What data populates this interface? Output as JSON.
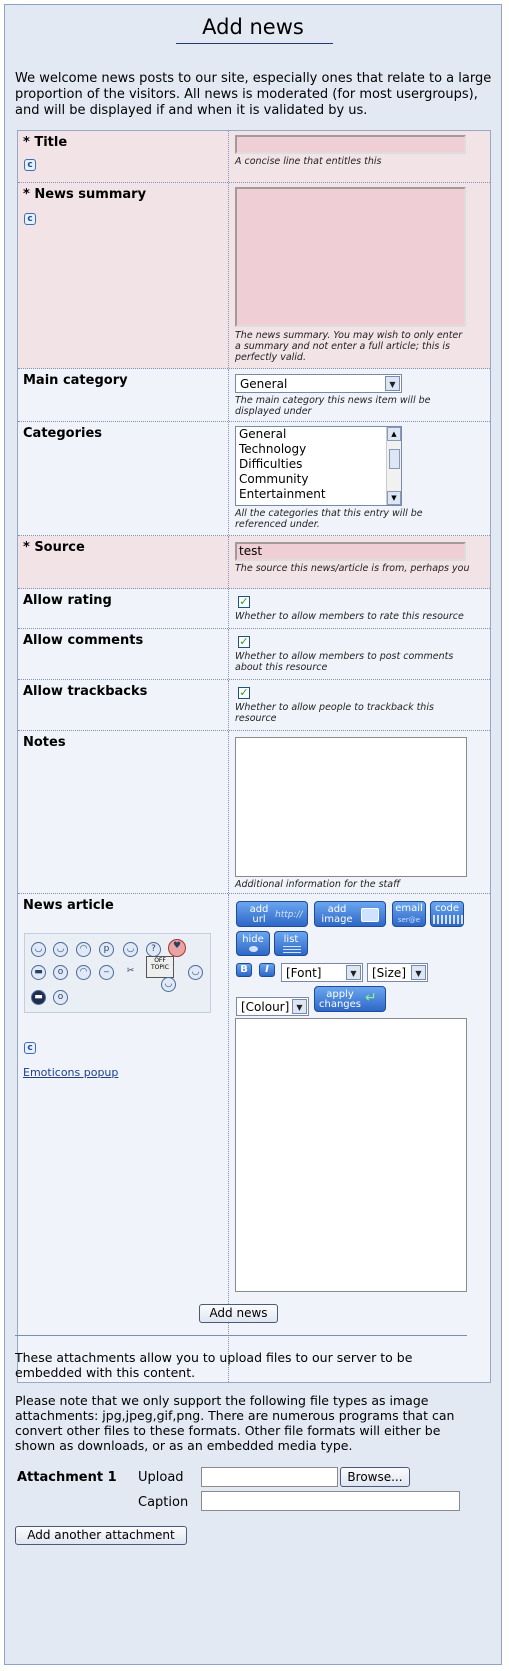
{
  "page": {
    "title": "Add news",
    "intro": "We welcome news posts to our site, especially ones that relate to a large proportion of the visitors. All news is moderated (for most usergroups), and will be displayed if and when it is validated by us."
  },
  "fields": {
    "title": {
      "label": "* Title",
      "value": "",
      "hint": "A concise line that entitles this"
    },
    "summary": {
      "label": "* News summary",
      "value": "",
      "hint": "The news summary. You may wish to only enter a summary and not enter a full article; this is perfectly valid."
    },
    "main_category": {
      "label": "Main category",
      "selected": "General",
      "hint": "The main category this news item will be displayed under"
    },
    "categories": {
      "label": "Categories",
      "options": [
        "General",
        "Technology",
        "Difficulties",
        "Community",
        "Entertainment"
      ],
      "hint": "All the categories that this entry will be referenced under."
    },
    "source": {
      "label": "* Source",
      "value": "test",
      "hint": "The source this news/article is from, perhaps you"
    },
    "allow_rating": {
      "label": "Allow rating",
      "checked": true,
      "hint": "Whether to allow members to rate this resource"
    },
    "allow_comments": {
      "label": "Allow comments",
      "checked": true,
      "hint": "Whether to allow members to post comments about this resource"
    },
    "allow_trackbacks": {
      "label": "Allow trackbacks",
      "checked": true,
      "hint": "Whether to allow people to trackback this resource"
    },
    "notes": {
      "label": "Notes",
      "value": "",
      "hint": "Additional information for the staff"
    },
    "article": {
      "label": "News article",
      "emoticons_link": "Emoticons popup",
      "toolbar": {
        "add_url": "add url",
        "add_url_tag": "http://",
        "add_image": "add image",
        "email": "email",
        "email_tag": "ser@e",
        "code": "code",
        "hide": "hide",
        "list": "list",
        "bold": "B",
        "italic": "I",
        "font": "[Font]",
        "size": "[Size]",
        "colour": "[Colour]",
        "apply": "apply changes",
        "off_topic": "OFF TOPIC"
      }
    }
  },
  "submit_label": "Add news",
  "attachments": {
    "info1": "These attachments allow you to upload files to our server to be embedded with this content.",
    "info2": "Please note that we only support the following file types as image attachments: jpg,jpeg,gif,png. There are numerous programs that can convert other files to these formats. Other file formats will either be shown as downloads, or as an embedded media type.",
    "item_label": "Attachment 1",
    "upload_label": "Upload",
    "browse_label": "Browse...",
    "caption_label": "Caption",
    "add_another": "Add another attachment"
  }
}
